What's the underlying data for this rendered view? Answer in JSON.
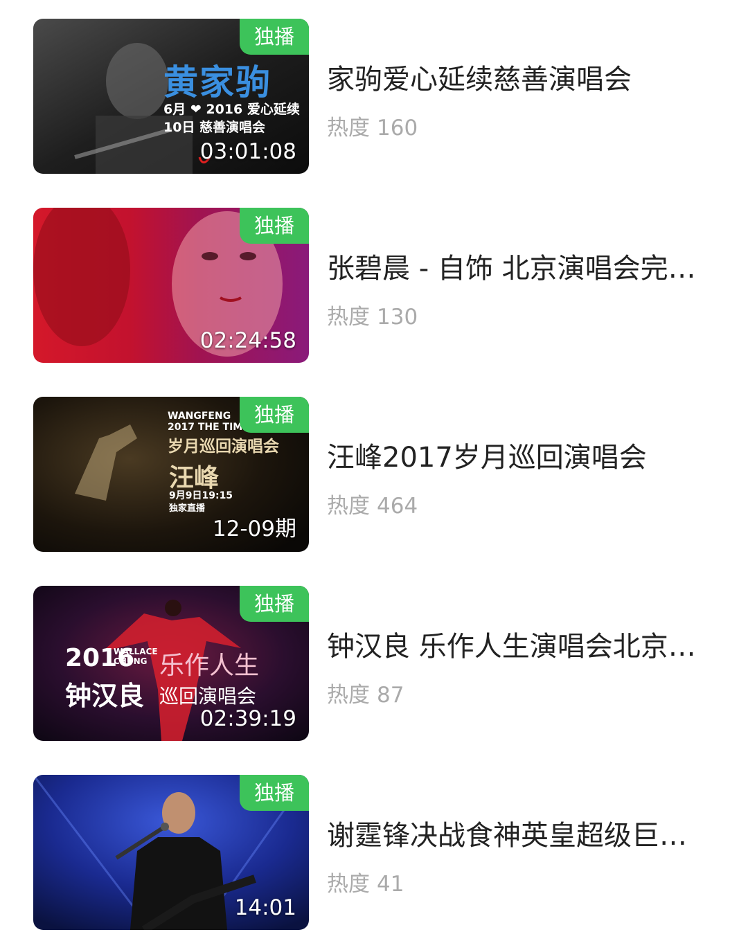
{
  "items": [
    {
      "badge": "独播",
      "duration": "03:01:08",
      "title": "家驹爱心延续慈善演唱会",
      "heat_label": "热度",
      "heat_value": "160",
      "poster": {
        "line1": "黄家驹",
        "line2": "6月 ❤ 2016 爱心延续",
        "line3": "10日 慈善演唱会"
      }
    },
    {
      "badge": "独播",
      "duration": "02:24:58",
      "title": "张碧晨 - 自饰 北京演唱会完…",
      "heat_label": "热度",
      "heat_value": "130"
    },
    {
      "badge": "独播",
      "duration": "12-09期",
      "title": "汪峰2017岁月巡回演唱会",
      "heat_label": "热度",
      "heat_value": "464",
      "poster": {
        "line1": "WANGFENG",
        "line2": "2017 THE TIME",
        "line3": "岁月巡回演唱会",
        "line4": "汪峰",
        "line5": "9月9日19:15",
        "line6": "独家直播"
      }
    },
    {
      "badge": "独播",
      "duration": "02:39:19",
      "title": "钟汉良 乐作人生演唱会北京…",
      "heat_label": "热度",
      "heat_value": "87",
      "poster": {
        "line1": "2016",
        "line2": "WALLACE CHUNG",
        "line3": "乐作人生",
        "line4": "钟汉良",
        "line5": "巡回演唱会"
      }
    },
    {
      "badge": "独播",
      "duration": "14:01",
      "title": "谢霆锋决战食神英皇超级巨…",
      "heat_label": "热度",
      "heat_value": "41"
    }
  ],
  "colors": {
    "badge_green": "#3dc35a",
    "title_text": "#222222",
    "heat_text": "#aaaaaa"
  }
}
